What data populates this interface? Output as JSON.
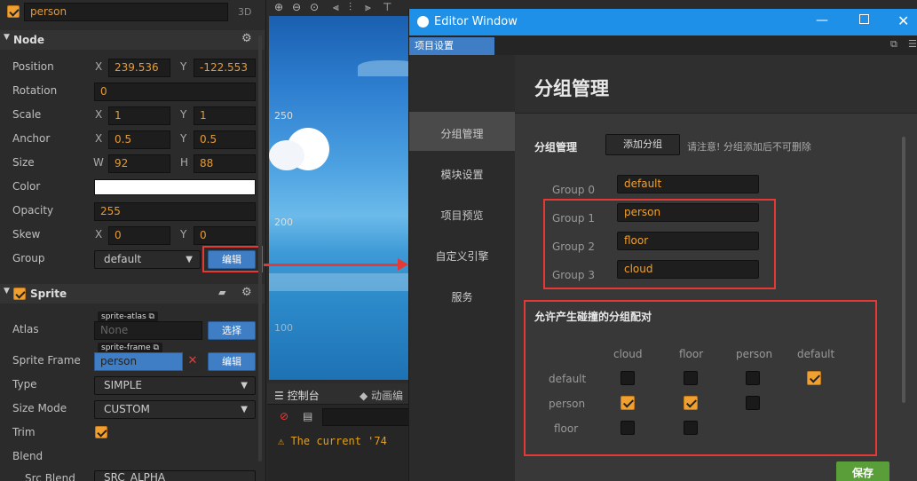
{
  "inspector": {
    "node_name": "person",
    "mode_3d": "3D",
    "node_section": "Node",
    "position": {
      "label": "Position",
      "x": "239.536",
      "y": "-122.553"
    },
    "rotation": {
      "label": "Rotation",
      "value": "0"
    },
    "scale": {
      "label": "Scale",
      "x": "1",
      "y": "1"
    },
    "anchor": {
      "label": "Anchor",
      "x": "0.5",
      "y": "0.5"
    },
    "size": {
      "label": "Size",
      "w": "92",
      "h": "88"
    },
    "color": {
      "label": "Color",
      "value": "#ffffff"
    },
    "opacity": {
      "label": "Opacity",
      "value": "255"
    },
    "skew": {
      "label": "Skew",
      "x": "0",
      "y": "0"
    },
    "group": {
      "label": "Group",
      "value": "default",
      "edit_button": "编辑"
    },
    "axis_x": "X",
    "axis_y": "Y",
    "axis_w": "W",
    "axis_h": "H",
    "sprite_section": "Sprite",
    "atlas": {
      "label": "Atlas",
      "tag": "sprite-atlas",
      "value": "None",
      "button": "选择"
    },
    "sprite_frame": {
      "label": "Sprite Frame",
      "tag": "sprite-frame",
      "value": "person",
      "button": "编辑"
    },
    "type": {
      "label": "Type",
      "value": "SIMPLE"
    },
    "size_mode": {
      "label": "Size Mode",
      "value": "CUSTOM"
    },
    "trim": {
      "label": "Trim",
      "checked": true
    },
    "blend": {
      "label": "Blend"
    },
    "src_blend": {
      "label": "Src Blend",
      "value": "SRC_ALPHA"
    }
  },
  "scene": {
    "ruler_250": "250",
    "ruler_200": "200",
    "ruler_100": "100",
    "console_tab": "控制台",
    "anim_tab": "动画编",
    "log_text": "The current '74"
  },
  "editor_window": {
    "title": "Editor Window",
    "tab": "项目设置",
    "nav": [
      "分组管理",
      "模块设置",
      "项目预览",
      "自定义引擎",
      "服务"
    ],
    "heading": "分组管理",
    "group_mgmt_label": "分组管理",
    "add_group_button": "添加分组",
    "note": "请注意! 分组添加后不可删除",
    "groups": [
      {
        "label": "Group 0",
        "name": "default"
      },
      {
        "label": "Group 1",
        "name": "person"
      },
      {
        "label": "Group 2",
        "name": "floor"
      },
      {
        "label": "Group 3",
        "name": "cloud"
      }
    ],
    "collision_title": "允许产生碰撞的分组配对",
    "matrix_cols": [
      "cloud",
      "floor",
      "person",
      "default"
    ],
    "matrix_rows": [
      "default",
      "person",
      "floor"
    ],
    "save_button": "保存"
  },
  "colors": {
    "accent": "#f0a030",
    "button_blue": "#3f7dc4",
    "titlebar": "#1e90e8",
    "highlight_red": "#e53935",
    "save_green": "#5a9e3a"
  }
}
